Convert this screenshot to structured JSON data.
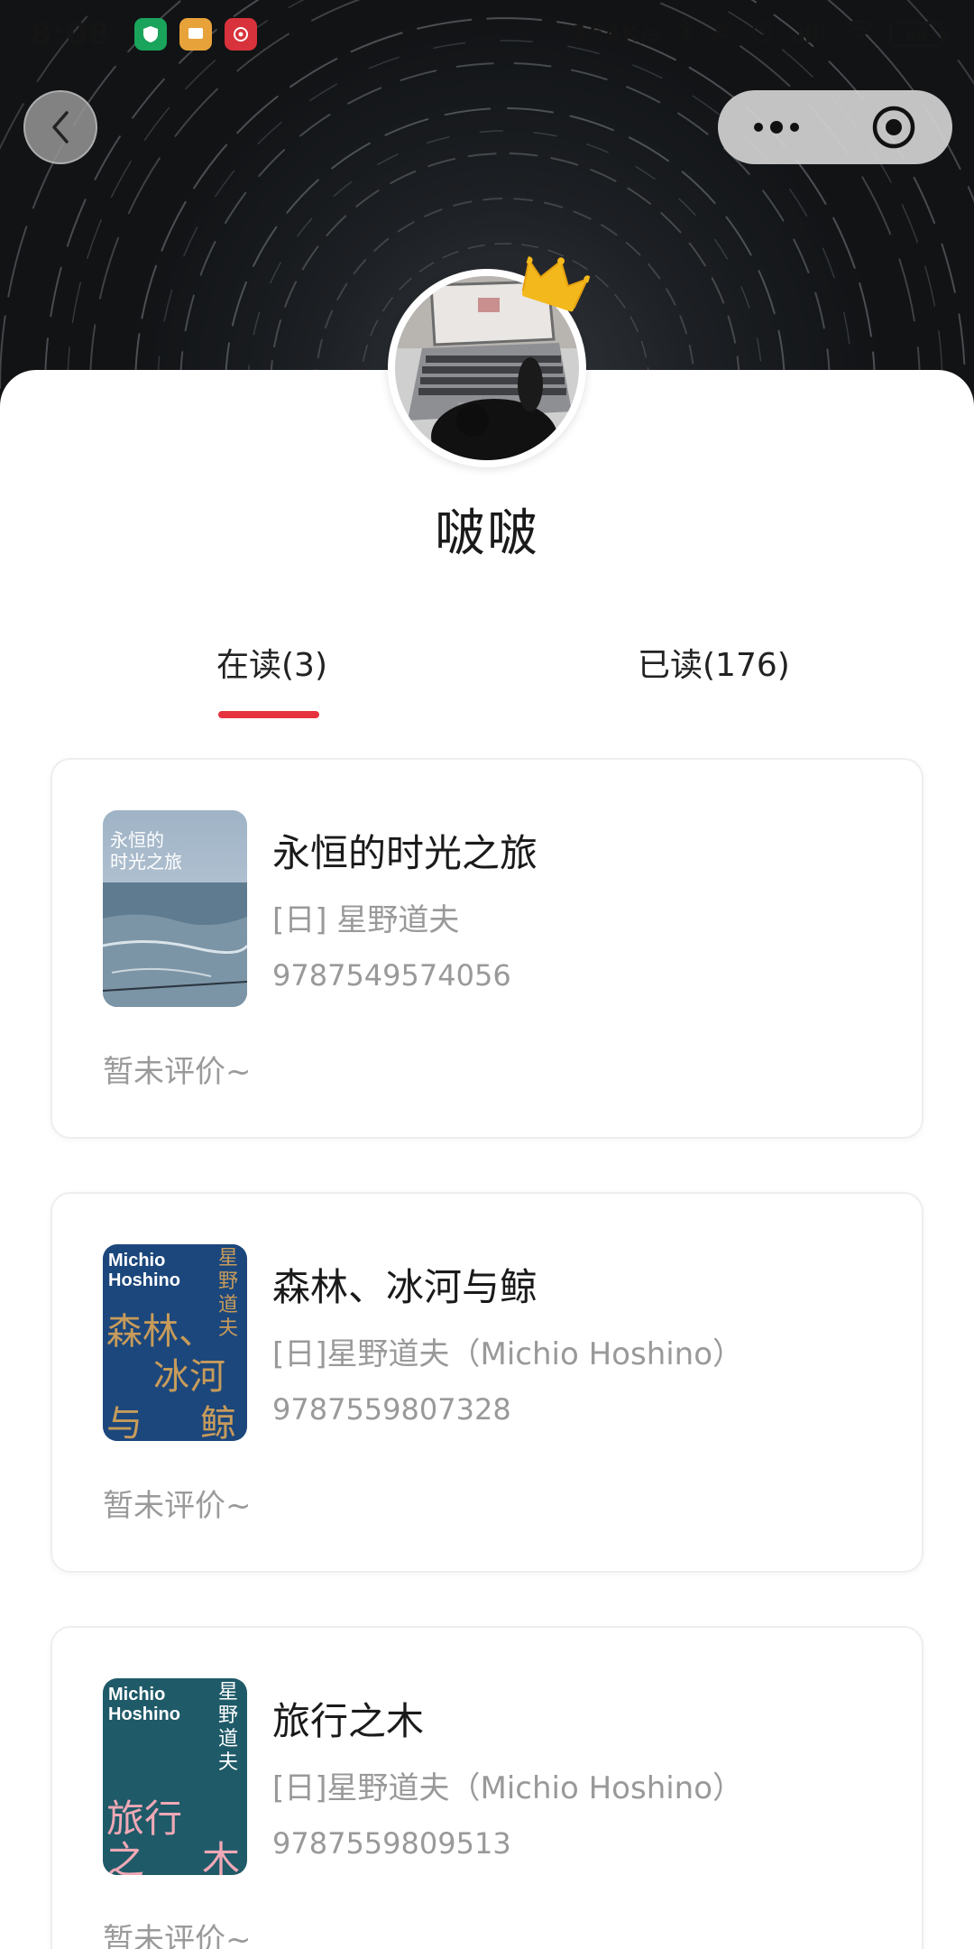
{
  "status_bar": {
    "time": "8:08",
    "more": "···",
    "speed": "154K/s",
    "battery": "84"
  },
  "profile": {
    "name": "啵啵"
  },
  "tabs": [
    {
      "label": "在读(3)",
      "active": true
    },
    {
      "label": "已读(176)",
      "active": false
    }
  ],
  "books": [
    {
      "title": "永恒的时光之旅",
      "author": "[日] 星野道夫",
      "isbn": "9787549574056",
      "rating": "暂未评价~",
      "cover_text": "永恒的时光之旅"
    },
    {
      "title": "森林、冰河与鲸",
      "author": "[日]星野道夫（Michio Hoshino）",
      "isbn": "9787559807328",
      "rating": "暂未评价~",
      "cover_text": "Michio Hoshino 森林、冰河与鲸 星野道夫 著"
    },
    {
      "title": "旅行之木",
      "author": "[日]星野道夫（Michio Hoshino）",
      "isbn": "9787559809513",
      "rating": "暂未评价~",
      "cover_text": "Michio Hoshino 旅行之木 星野道夫"
    }
  ],
  "colors": {
    "accent": "#e5323e",
    "muted_text": "#999999",
    "hero_bg": "#1c1f23"
  },
  "icons": [
    "back-arrow-icon",
    "more-dots-icon",
    "target-icon",
    "crown-icon"
  ]
}
